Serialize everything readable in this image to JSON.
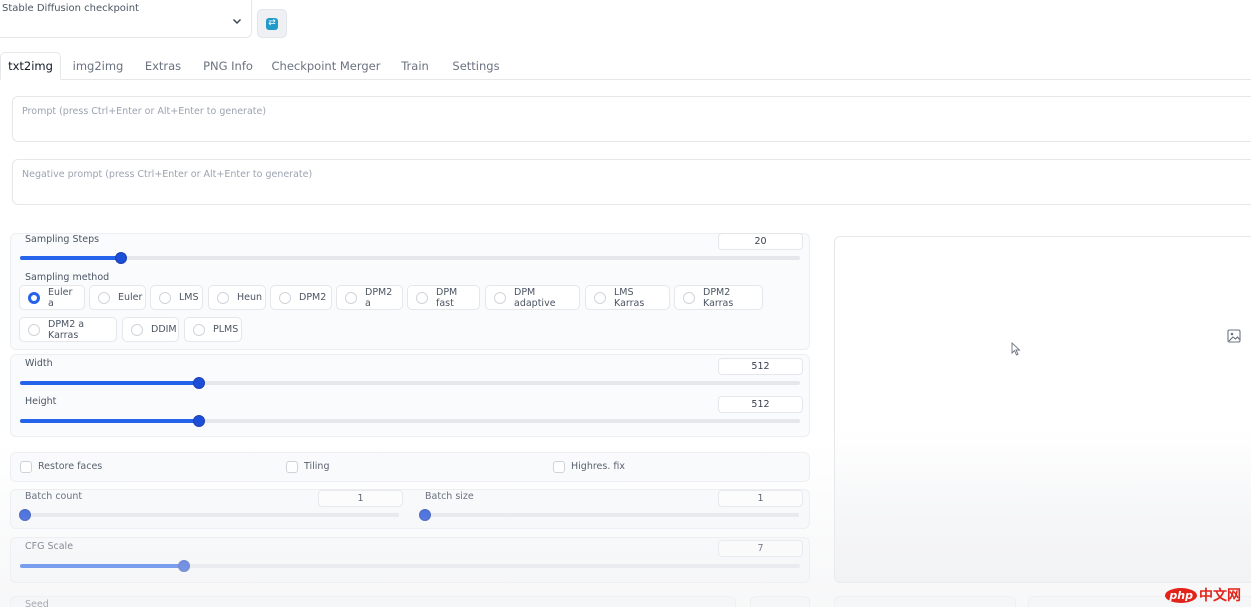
{
  "checkpoint": {
    "label": "Stable Diffusion checkpoint",
    "value": ""
  },
  "tabs": [
    {
      "label": "txt2img",
      "active": true
    },
    {
      "label": "img2img"
    },
    {
      "label": "Extras"
    },
    {
      "label": "PNG Info"
    },
    {
      "label": "Checkpoint Merger"
    },
    {
      "label": "Train"
    },
    {
      "label": "Settings"
    }
  ],
  "prompt": {
    "placeholder": "Prompt (press Ctrl+Enter or Alt+Enter to generate)"
  },
  "negative_prompt": {
    "placeholder": "Negative prompt (press Ctrl+Enter or Alt+Enter to generate)"
  },
  "sampling_steps": {
    "label": "Sampling Steps",
    "value": "20",
    "fraction": 0.13
  },
  "sampling_method": {
    "label": "Sampling method",
    "selected": "Euler a",
    "options": [
      "Euler a",
      "Euler",
      "LMS",
      "Heun",
      "DPM2",
      "DPM2 a",
      "DPM fast",
      "DPM adaptive",
      "LMS Karras",
      "DPM2 Karras",
      "DPM2 a Karras",
      "DDIM",
      "PLMS"
    ]
  },
  "width": {
    "label": "Width",
    "value": "512",
    "fraction": 0.23
  },
  "height": {
    "label": "Height",
    "value": "512",
    "fraction": 0.23
  },
  "checkboxes": {
    "restore_faces": "Restore faces",
    "tiling": "Tiling",
    "highres_fix": "Highres. fix"
  },
  "batch_count": {
    "label": "Batch count",
    "value": "1",
    "fraction": 0.0
  },
  "batch_size": {
    "label": "Batch size",
    "value": "1",
    "fraction": 0.0
  },
  "cfg_scale": {
    "label": "CFG Scale",
    "value": "7",
    "fraction": 0.2
  },
  "seed": {
    "label": "Seed"
  },
  "watermark": {
    "brand": "php",
    "text": "中文网"
  },
  "colors": {
    "accent": "#2563eb",
    "refresh": "#1f9ac9"
  },
  "icons": {
    "refresh": "refresh-icon",
    "chevron": "chevron-down-icon",
    "image": "image-icon",
    "cursor": "cursor-icon"
  }
}
